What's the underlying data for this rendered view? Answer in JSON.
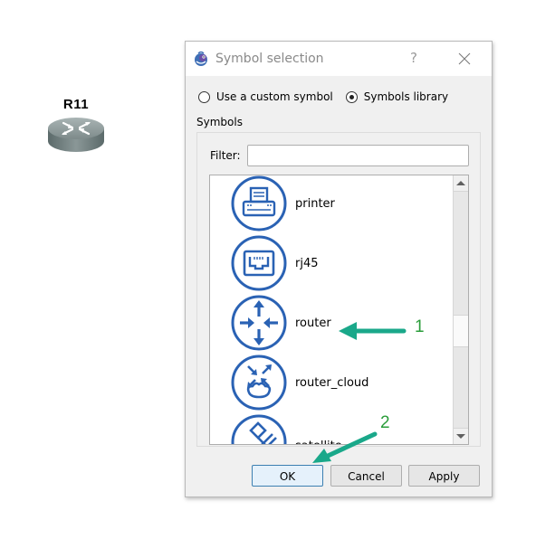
{
  "canvas": {
    "node": {
      "label": "R11",
      "icon": "router-device-icon"
    }
  },
  "dialog": {
    "title": "Symbol selection",
    "app_icon": "gns3-chameleon-icon",
    "help_label": "?",
    "close_icon": "close-icon",
    "source_options": [
      {
        "label": "Use a custom symbol",
        "checked": false
      },
      {
        "label": "Symbols library",
        "checked": true
      }
    ],
    "group_label": "Symbols",
    "filter": {
      "label": "Filter:",
      "value": "",
      "placeholder": ""
    },
    "symbols": [
      {
        "label": "printer",
        "icon": "printer-icon"
      },
      {
        "label": "rj45",
        "icon": "rj45-icon"
      },
      {
        "label": "router",
        "icon": "router-icon"
      },
      {
        "label": "router_cloud",
        "icon": "router-cloud-icon"
      },
      {
        "label": "satellite",
        "icon": "satellite-icon"
      }
    ],
    "scroll_position": 0.55,
    "buttons": {
      "ok": "OK",
      "cancel": "Cancel",
      "apply": "Apply"
    }
  },
  "annotations": [
    {
      "number": "1",
      "target": "router",
      "color": "#1aa88a"
    },
    {
      "number": "2",
      "target": "OK",
      "color": "#1aa88a"
    }
  ],
  "colors": {
    "icon_blue": "#2a62b4",
    "annotation_arrow": "#1aa88a",
    "annotation_number": "#2a9d3a"
  }
}
